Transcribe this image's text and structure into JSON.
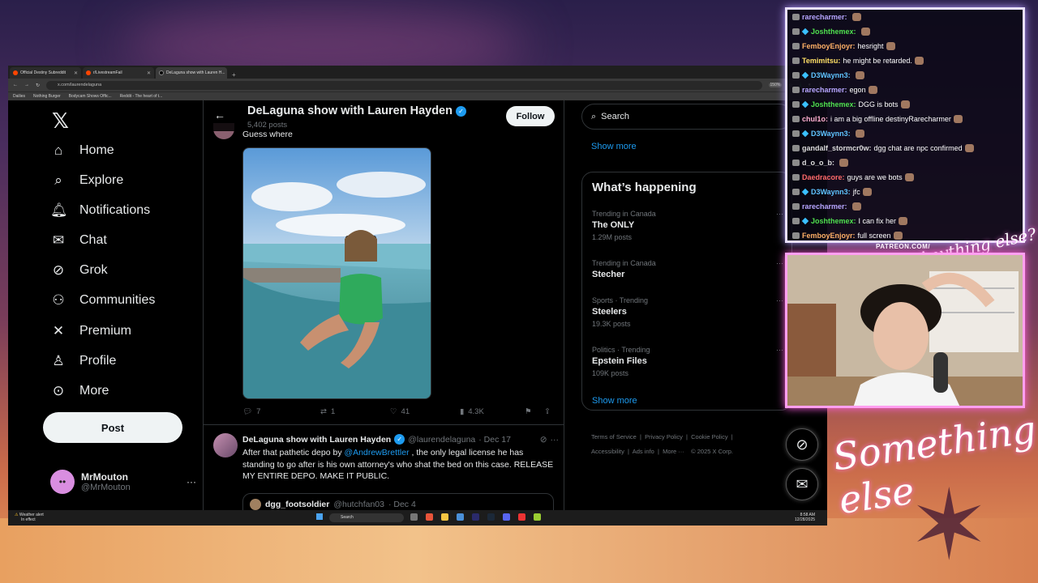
{
  "browser": {
    "tabs": [
      {
        "label": "Official Destiny Subreddit",
        "active": false
      },
      {
        "label": "r/LivestreamFail",
        "active": false
      },
      {
        "label": "DeLaguna show with Lauren H...",
        "active": true
      }
    ],
    "url": "x.com/laurendelaguna",
    "zoom": "150%",
    "bookmarks": [
      "Dailies",
      "Nothing Burger",
      "Bodycam Shows Offic...",
      "Reddit - The heart of t..."
    ]
  },
  "sidebar": {
    "nav": [
      {
        "label": "Home",
        "icon": "home-icon"
      },
      {
        "label": "Explore",
        "icon": "search-icon"
      },
      {
        "label": "Notifications",
        "icon": "bell-icon"
      },
      {
        "label": "Chat",
        "icon": "mail-icon"
      },
      {
        "label": "Grok",
        "icon": "grok-icon"
      },
      {
        "label": "Communities",
        "icon": "people-icon"
      },
      {
        "label": "Premium",
        "icon": "x-icon"
      },
      {
        "label": "Profile",
        "icon": "person-icon"
      },
      {
        "label": "More",
        "icon": "more-circle-icon"
      }
    ],
    "post_label": "Post",
    "account": {
      "name": "MrMouton",
      "handle": "@MrMouton"
    }
  },
  "profile_header": {
    "title": "DeLaguna show with Lauren Hayden",
    "posts": "5,402 posts",
    "follow_label": "Follow"
  },
  "tweet1": {
    "text": "Guess where",
    "replies": "7",
    "reposts": "1",
    "likes": "41",
    "views": "4.3K"
  },
  "tweet2": {
    "name": "DeLaguna show with Lauren Hayden",
    "handle": "@laurendelaguna",
    "date": "· Dec 17",
    "text_before": "After that pathetic depo by ",
    "mention": "@AndrewBrettler",
    "text_after": " , the only legal license he has standing to go after is his own attorney's who shat the bed on this case. RELEASE MY ENTIRE DEPO. MAKE IT PUBLIC.",
    "quote": {
      "name": "dgg_footsoldier",
      "handle": "@hutchfan03",
      "date": "· Dec 4"
    }
  },
  "right": {
    "search_placeholder": "Search",
    "show_more": "Show more",
    "happening_title": "What’s happening",
    "trends": [
      {
        "context": "Trending in Canada",
        "title": "The ONLY",
        "posts": "1.29M posts"
      },
      {
        "context": "Trending in Canada",
        "title": "Stecher",
        "posts": ""
      },
      {
        "context": "Sports · Trending",
        "title": "Steelers",
        "posts": "19.3K posts"
      },
      {
        "context": "Politics · Trending",
        "title": "Epstein Files",
        "posts": "109K posts"
      }
    ],
    "footer": {
      "line1": [
        "Terms of Service",
        "Privacy Policy",
        "Cookie Policy"
      ],
      "line2": [
        "Accessibility",
        "Ads info",
        "More ···",
        "© 2025 X Corp."
      ]
    }
  },
  "taskbar": {
    "weather_title": "Weather alert",
    "weather_sub": "In effect",
    "search": "Search",
    "time": "8:58 AM",
    "date": "12/28/2025"
  },
  "chat": [
    {
      "user": "rarecharmer:",
      "msg": "",
      "color": "#b7a6ff",
      "gem": false
    },
    {
      "user": "Joshthemex:",
      "msg": "",
      "color": "#4fe04f",
      "gem": true
    },
    {
      "user": "FemboyEnjoyr:",
      "msg": "hesright",
      "color": "#ffb066",
      "gem": false
    },
    {
      "user": "Temimitsu:",
      "msg": "he might be retarded.",
      "color": "#ffe066",
      "gem": false
    },
    {
      "user": "D3Waynn3:",
      "msg": "",
      "color": "#5fc3ff",
      "gem": true
    },
    {
      "user": "rarecharmer:",
      "msg": "egon",
      "color": "#b7a6ff",
      "gem": false
    },
    {
      "user": "Joshthemex:",
      "msg": "DGG is bots",
      "color": "#4fe04f",
      "gem": true
    },
    {
      "user": "chul1o:",
      "msg": "i am a big offline destinyRarecharmer",
      "color": "#ffb0d0",
      "gem": false
    },
    {
      "user": "D3Waynn3:",
      "msg": "",
      "color": "#5fc3ff",
      "gem": true
    },
    {
      "user": "gandalf_stormcr0w:",
      "msg": "dgg chat are npc confirmed",
      "color": "#dddddd",
      "gem": false
    },
    {
      "user": "d_o_o_b:",
      "msg": "",
      "color": "#dddddd",
      "gem": false
    },
    {
      "user": "Daedracore:",
      "msg": "guys are we bots",
      "color": "#ff6a6a",
      "gem": false
    },
    {
      "user": "D3Waynn3:",
      "msg": "jfc",
      "color": "#5fc3ff",
      "gem": true
    },
    {
      "user": "rarecharmer:",
      "msg": "",
      "color": "#b7a6ff",
      "gem": false
    },
    {
      "user": "Joshthemex:",
      "msg": "I can fix her",
      "color": "#4fe04f",
      "gem": true
    },
    {
      "user": "FemboyEnjoyr:",
      "msg": "full screen",
      "color": "#ffb066",
      "gem": false
    }
  ],
  "overlay": {
    "patreon": "PATREON.COM/",
    "sig_small": "Anything else?",
    "sig_big": "Something else"
  }
}
